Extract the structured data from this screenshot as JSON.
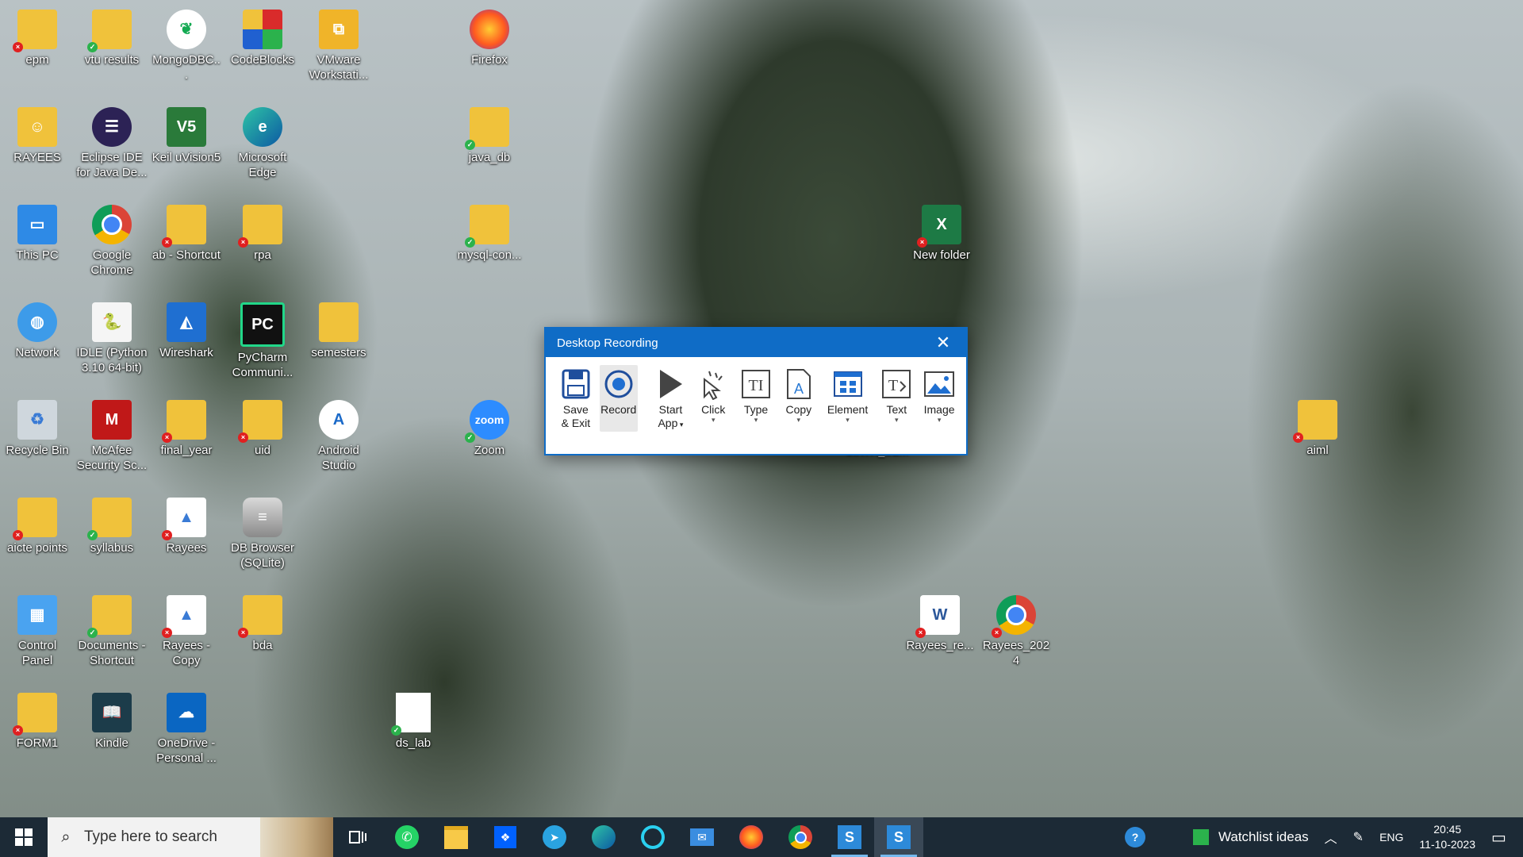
{
  "desktop_icons": [
    {
      "label": "epm",
      "badge": "err"
    },
    {
      "label": "vtu results",
      "badge": "ok"
    },
    {
      "label": "MongoDBC...",
      "badge": "ok"
    },
    {
      "label": "CodeBlocks",
      "badge": "ok"
    },
    {
      "label": "VMware Workstati...",
      "badge": "shortcut"
    },
    {
      "label": "Firefox",
      "badge": "shortcut"
    },
    {
      "label": "RAYEES",
      "badge": "none"
    },
    {
      "label": "Eclipse IDE for Java De...",
      "badge": "ok"
    },
    {
      "label": "Keil uVision5",
      "badge": "ok"
    },
    {
      "label": "Microsoft Edge",
      "badge": "shortcut"
    },
    {
      "label": "java_db",
      "badge": "ok"
    },
    {
      "label": "This PC",
      "badge": "none"
    },
    {
      "label": "Google Chrome",
      "badge": "shortcut"
    },
    {
      "label": "ab - Shortcut",
      "badge": "err"
    },
    {
      "label": "rpa",
      "badge": "err"
    },
    {
      "label": "mysql-con...",
      "badge": "ok"
    },
    {
      "label": "New folder",
      "badge": "err"
    },
    {
      "label": "Network",
      "badge": "none"
    },
    {
      "label": "IDLE (Python 3.10 64-bit)",
      "badge": "ok"
    },
    {
      "label": "Wireshark",
      "badge": "shortcut"
    },
    {
      "label": "PyCharm Communi...",
      "badge": "shortcut"
    },
    {
      "label": "semesters",
      "badge": "none"
    },
    {
      "label": "Recycle Bin",
      "badge": "none"
    },
    {
      "label": "McAfee Security Sc...",
      "badge": "shortcut"
    },
    {
      "label": "final_year",
      "badge": "err"
    },
    {
      "label": "uid",
      "badge": "err"
    },
    {
      "label": "Android Studio",
      "badge": "shortcut"
    },
    {
      "label": "Zoom",
      "badge": "ok"
    },
    {
      "label": "aiml",
      "badge": "err"
    },
    {
      "label": "aicte points",
      "badge": "err"
    },
    {
      "label": "syllabus",
      "badge": "ok"
    },
    {
      "label": "Rayees",
      "badge": "err"
    },
    {
      "label": "DB Browser (SQLite)",
      "badge": "shortcut"
    },
    {
      "label": "Control Panel",
      "badge": "none"
    },
    {
      "label": "Documents - Shortcut",
      "badge": "ok"
    },
    {
      "label": "Rayees - Copy",
      "badge": "err"
    },
    {
      "label": "bda",
      "badge": "err"
    },
    {
      "label": "Rayees_re...",
      "badge": "err"
    },
    {
      "label": "Rayees_2024",
      "badge": "err"
    },
    {
      "label": "FORM1",
      "badge": "err"
    },
    {
      "label": "Kindle",
      "badge": "ok"
    },
    {
      "label": "OneDrive - Personal ...",
      "badge": "ok"
    },
    {
      "label": "ds_lab",
      "badge": "ok"
    }
  ],
  "partially_hidden_label": "SIXTH_SEM",
  "dialog": {
    "title": "Desktop Recording",
    "close_icon": "close-icon",
    "tools": [
      {
        "label_line1": "Save",
        "label_line2": "& Exit",
        "icon": "save-icon"
      },
      {
        "label_line1": "Record",
        "label_line2": "",
        "icon": "record-icon",
        "selected": true
      },
      {
        "label_line1": "Start",
        "label_line2": "App",
        "icon": "play-icon",
        "dropdown": true
      },
      {
        "label_line1": "Click",
        "label_line2": "",
        "icon": "cursor-click-icon",
        "dropdown": true
      },
      {
        "label_line1": "Type",
        "label_line2": "",
        "icon": "type-icon",
        "dropdown": true
      },
      {
        "label_line1": "Copy",
        "label_line2": "",
        "icon": "copy-text-icon",
        "dropdown": true
      },
      {
        "label_line1": "Element",
        "label_line2": "",
        "icon": "element-icon",
        "dropdown": true
      },
      {
        "label_line1": "Text",
        "label_line2": "",
        "icon": "text-icon",
        "dropdown": true
      },
      {
        "label_line1": "Image",
        "label_line2": "",
        "icon": "image-icon",
        "dropdown": true
      }
    ]
  },
  "taskbar": {
    "search_placeholder": "Type here to search",
    "apps": [
      "task-view-icon",
      "whatsapp-icon",
      "file-explorer-icon",
      "dropbox-icon",
      "telegram-icon",
      "edge-icon",
      "cortana-icon",
      "mail-icon",
      "firefox-icon",
      "chrome-icon",
      "uipath-studio-icon",
      "uipath-recorder-icon"
    ],
    "watchlist": "Watchlist ideas",
    "language": "ENG",
    "time": "20:45",
    "date": "11-10-2023"
  },
  "colors": {
    "dialog_title_bg": "#0f6cc6",
    "taskbar_bg": "#1c2a36"
  }
}
